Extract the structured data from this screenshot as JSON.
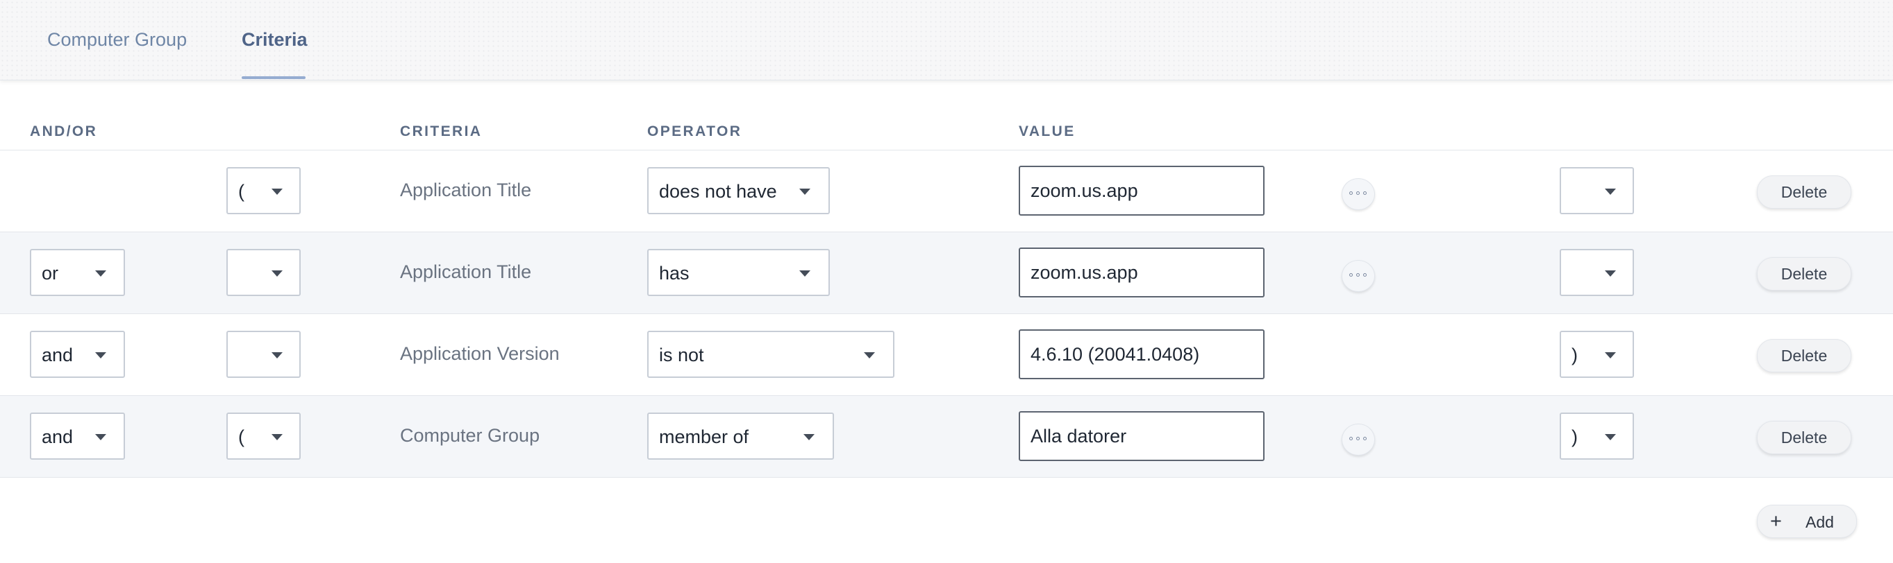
{
  "tabs": [
    {
      "label": "Computer Group",
      "active": false
    },
    {
      "label": "Criteria",
      "active": true
    }
  ],
  "columns": {
    "andor": "AND/OR",
    "criteria": "CRITERIA",
    "operator": "OPERATOR",
    "value": "VALUE"
  },
  "rows": [
    {
      "andor": "",
      "open_paren": "(",
      "criteria": "Application Title",
      "operator": "does not have",
      "value": "zoom.us.app",
      "close_paren": "",
      "delete_label": "Delete"
    },
    {
      "andor": "or",
      "open_paren": "",
      "criteria": "Application Title",
      "operator": "has",
      "value": "zoom.us.app",
      "close_paren": "",
      "delete_label": "Delete"
    },
    {
      "andor": "and",
      "open_paren": "",
      "criteria": "Application Version",
      "operator": "is not",
      "value": "4.6.10 (20041.0408)",
      "close_paren": ")",
      "delete_label": "Delete"
    },
    {
      "andor": "and",
      "open_paren": "(",
      "criteria": "Computer Group",
      "operator": "member of",
      "value": "Alla datorer",
      "close_paren": ")",
      "delete_label": "Delete"
    }
  ],
  "add": {
    "icon": "plus-icon",
    "label": "Add"
  },
  "icons": {
    "caret": "caret-down-icon",
    "more": "ellipsis-icon"
  },
  "colors": {
    "tab_active": "#4f6488",
    "tab_inactive": "#6f86a6",
    "row_alt": "#f4f6f9"
  }
}
